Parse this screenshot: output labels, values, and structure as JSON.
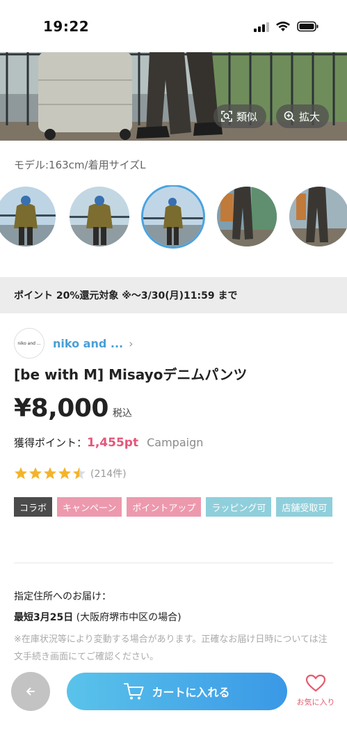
{
  "status_bar": {
    "time": "19:22"
  },
  "hero": {
    "similar_label": "類似",
    "zoom_label": "拡大"
  },
  "model_info": "モデル:163cm/着用サイズL",
  "thumbnails": {
    "count": 5,
    "selected_index": 2
  },
  "point_banner": "ポイント 20%還元対象 ※～3/30(月)11:59 まで",
  "brand": {
    "logo_text": "niko and ...",
    "name": "niko and ..."
  },
  "product": {
    "title": "[be with M] Misayoデニムパンツ",
    "price": "¥8,000",
    "tax_label": "税込",
    "points_label": "獲得ポイント：",
    "points_value": "1,455pt",
    "campaign_label": "Campaign",
    "rating": 4.5,
    "review_count": "(214件)"
  },
  "tags": [
    {
      "label": "コラボ",
      "color": "#4b4b4b"
    },
    {
      "label": "キャンペーン",
      "color": "#ed99ad"
    },
    {
      "label": "ポイントアップ",
      "color": "#ed99ad"
    },
    {
      "label": "ラッピング可",
      "color": "#8fcfdb"
    },
    {
      "label": "店舗受取可",
      "color": "#8fcfdb"
    }
  ],
  "delivery": {
    "label": "指定住所へのお届け：",
    "date": "最短3月25日",
    "location": " (大阪府堺市中区の場合)",
    "note": "※在庫状況等により変動する場合があります。正確なお届け日時については注文手続き画面にてご確認ください。"
  },
  "bottom_bar": {
    "cart_label": "カートに入れる",
    "favorite_label": "お気に入り"
  },
  "colors": {
    "accent_blue": "#3a98e6",
    "points_pink": "#e6557a",
    "star": "#f3b42c"
  }
}
